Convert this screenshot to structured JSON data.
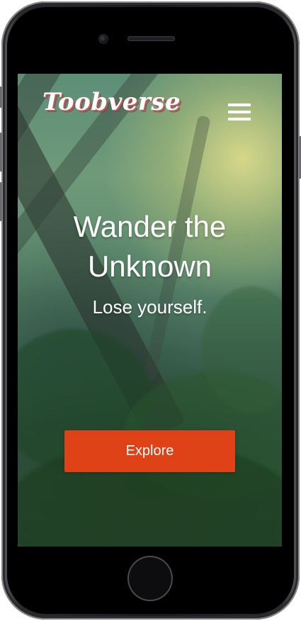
{
  "device": {
    "frame_color": "#1a1a1c",
    "screen_bg_colors": [
      "#5e8e77",
      "#2a4a34"
    ]
  },
  "header": {
    "brand": "Toobverse",
    "menu_icon": "hamburger-menu-icon"
  },
  "hero": {
    "title": "Wander the Unknown",
    "subtitle": "Lose yourself."
  },
  "cta": {
    "label": "Explore",
    "color": "#df4216"
  }
}
